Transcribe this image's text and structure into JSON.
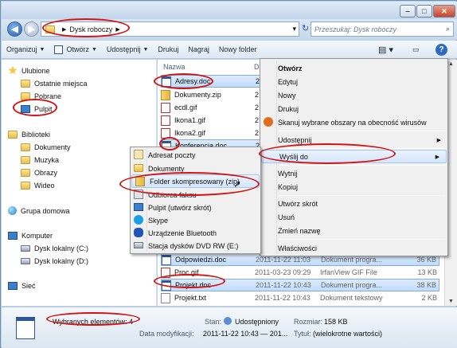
{
  "window": {
    "minimize": "‒",
    "maximize": "□",
    "close": "✕"
  },
  "nav": {
    "back": "◀",
    "forward": "▶",
    "breadcrumb_sep": "▶",
    "current": "Dysk roboczy",
    "dropdown": "▾",
    "refresh": "↻"
  },
  "search": {
    "placeholder": "Przeszukaj: Dysk roboczy",
    "icon": "search-icon"
  },
  "toolbar": {
    "organize": "Organizuj",
    "open": "Otwórz",
    "share": "Udostępnij",
    "print": "Drukuj",
    "burn": "Nagraj",
    "new_folder": "Nowy folder",
    "help": "?"
  },
  "sidebar": {
    "favorites": "Ulubione",
    "recent": "Ostatnie miejsca",
    "downloads": "Pobrane",
    "desktop": "Pulpit",
    "libraries": "Biblioteki",
    "documents": "Dokumenty",
    "music": "Muzyka",
    "pictures": "Obrazy",
    "videos": "Wideo",
    "homegroup": "Grupa domowa",
    "computer": "Komputer",
    "drive_c": "Dysk lokalny (C:)",
    "drive_d": "Dysk lokalny (D:)",
    "network": "Sieć"
  },
  "columns": {
    "name": "Nazwa",
    "date": "Da"
  },
  "files": [
    {
      "name": "Adresy.doc",
      "date": "2"
    },
    {
      "name": "Dokumenty.zip",
      "date": "2"
    },
    {
      "name": "ecdl.gif",
      "date": "2"
    },
    {
      "name": "Ikona1.gif",
      "date": "2"
    },
    {
      "name": "Ikona2.gif",
      "date": "2"
    },
    {
      "name": "Konferencja.doc",
      "date": "2"
    },
    {
      "name": "Odpowiedzi.doc",
      "date": "2011-11-22 11:03",
      "type": "Dokument progra...",
      "size": "36 KB"
    },
    {
      "name": "Proc.gif",
      "date": "2011-03-23 09:29",
      "type": "IrfanView GIF File",
      "size": "13 KB"
    },
    {
      "name": "Projekt.doc",
      "date": "2011-11-22 10:43",
      "type": "Dokument progra...",
      "size": "38 KB"
    },
    {
      "name": "Projekt.txt",
      "date": "2011-11-22 10:43",
      "type": "Dokument tekstowy",
      "size": "2 KB"
    }
  ],
  "context_menu": {
    "open": "Otwórz",
    "edit": "Edytuj",
    "new": "Nowy",
    "print": "Drukuj",
    "scan": "Skanuj wybrane obszary na obecność wirusów",
    "share": "Udostępnij",
    "send_to": "Wyślij do",
    "cut": "Wytnij",
    "copy": "Kopiuj",
    "shortcut": "Utwórz skrót",
    "delete": "Usuń",
    "rename": "Zmień nazwę",
    "properties": "Właściwości"
  },
  "sendto_menu": {
    "mail": "Adresat poczty",
    "documents": "Dokumenty",
    "zip": "Folder skompresowany (zip)",
    "fax": "Odbiorca faksu",
    "desktop": "Pulpit (utwórz skrót)",
    "skype": "Skype",
    "bluetooth": "Urządzenie Bluetooth",
    "dvd": "Stacja dysków DVD RW (E:)"
  },
  "status": {
    "selected": "Wybranych elementów: 4",
    "state_label": "Stan:",
    "state_value": "Udostępniony",
    "size_label": "Rozmiar:",
    "size_value": "158 KB",
    "modified_label": "Data modyfikacji:",
    "modified_value": "2011-11-22 10:43 — 201...",
    "title_label": "Tytuł:",
    "title_value": "(wielokrotne wartości)"
  },
  "colors": {
    "highlight": "#d11414",
    "selection": "#c1dcfa",
    "window_chrome": "#bcd3ea"
  }
}
